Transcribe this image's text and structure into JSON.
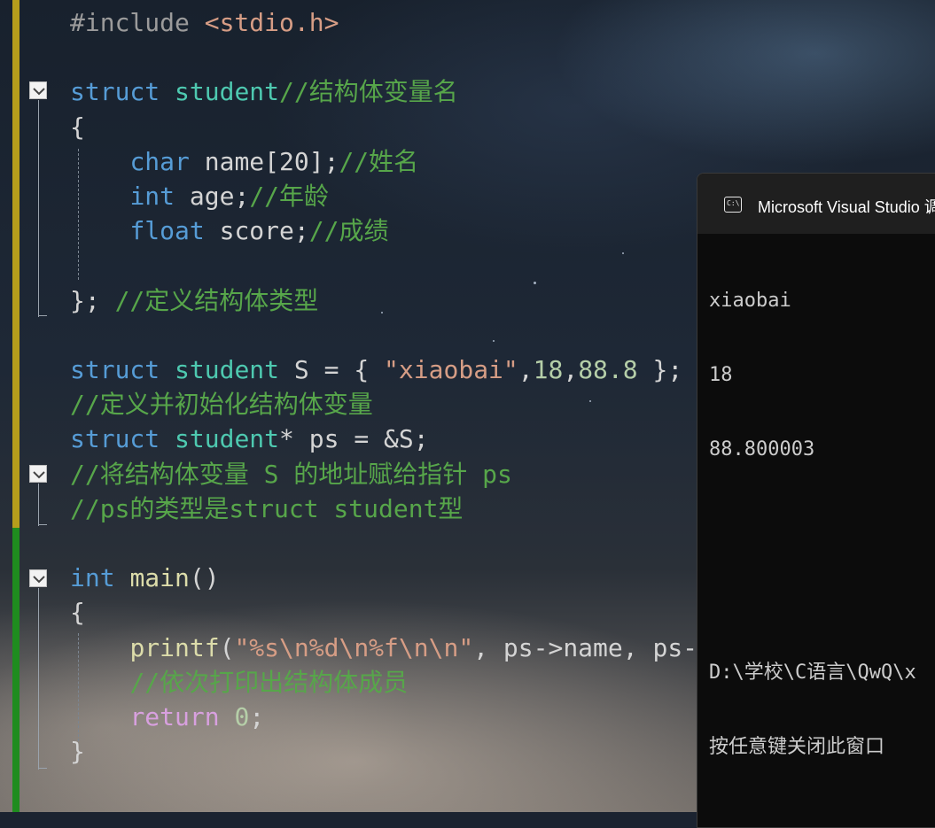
{
  "editor": {
    "lines": [
      {
        "tokens": [
          [
            "pp",
            "#include "
          ],
          [
            "st",
            "<stdio.h>"
          ]
        ]
      },
      {
        "tokens": []
      },
      {
        "tokens": [
          [
            "kw",
            "struct"
          ],
          [
            "pl",
            " "
          ],
          [
            "ty",
            "student"
          ],
          [
            "cm",
            "//结构体变量名"
          ]
        ]
      },
      {
        "tokens": [
          [
            "pl",
            "{"
          ]
        ]
      },
      {
        "tokens": [
          [
            "pl",
            "    "
          ],
          [
            "kw",
            "char"
          ],
          [
            "pl",
            " name[20];"
          ],
          [
            "cm",
            "//姓名"
          ]
        ]
      },
      {
        "tokens": [
          [
            "pl",
            "    "
          ],
          [
            "kw",
            "int"
          ],
          [
            "pl",
            " age;"
          ],
          [
            "cm",
            "//年龄"
          ]
        ]
      },
      {
        "tokens": [
          [
            "pl",
            "    "
          ],
          [
            "kw",
            "float"
          ],
          [
            "pl",
            " score;"
          ],
          [
            "cm",
            "//成绩"
          ]
        ]
      },
      {
        "tokens": []
      },
      {
        "tokens": [
          [
            "pl",
            "}; "
          ],
          [
            "cm",
            "//定义结构体类型"
          ]
        ]
      },
      {
        "tokens": []
      },
      {
        "tokens": [
          [
            "kw",
            "struct"
          ],
          [
            "pl",
            " "
          ],
          [
            "ty",
            "student"
          ],
          [
            "pl",
            " S = { "
          ],
          [
            "st",
            "\"xiaobai\""
          ],
          [
            "pl",
            ","
          ],
          [
            "nm",
            "18"
          ],
          [
            "pl",
            ","
          ],
          [
            "nm",
            "88.8"
          ],
          [
            "pl",
            " };"
          ]
        ]
      },
      {
        "tokens": [
          [
            "cm",
            "//定义并初始化结构体变量"
          ]
        ]
      },
      {
        "tokens": [
          [
            "kw",
            "struct"
          ],
          [
            "pl",
            " "
          ],
          [
            "ty",
            "student"
          ],
          [
            "pl",
            "* ps = &S;"
          ]
        ]
      },
      {
        "tokens": [
          [
            "cm",
            "//将结构体变量 S 的地址赋给指针 ps"
          ]
        ]
      },
      {
        "tokens": [
          [
            "cm",
            "//ps的类型是struct student型"
          ]
        ]
      },
      {
        "tokens": []
      },
      {
        "tokens": [
          [
            "kw",
            "int"
          ],
          [
            "pl",
            " "
          ],
          [
            "fn",
            "main"
          ],
          [
            "pl",
            "()"
          ]
        ]
      },
      {
        "tokens": [
          [
            "pl",
            "{"
          ]
        ]
      },
      {
        "tokens": [
          [
            "pl",
            "    "
          ],
          [
            "fn",
            "printf"
          ],
          [
            "pl",
            "("
          ],
          [
            "st",
            "\"%s\\n%d\\n%f\\n\\n\""
          ],
          [
            "pl",
            ", ps->name, ps->ag"
          ]
        ]
      },
      {
        "tokens": [
          [
            "pl",
            "    "
          ],
          [
            "cm",
            "//依次打印出结构体成员"
          ]
        ]
      },
      {
        "tokens": [
          [
            "pl",
            "    "
          ],
          [
            "ctl",
            "return"
          ],
          [
            "pl",
            " "
          ],
          [
            "nm",
            "0"
          ],
          [
            "pl",
            ";"
          ]
        ]
      },
      {
        "tokens": [
          [
            "pl",
            "}"
          ]
        ]
      }
    ]
  },
  "console": {
    "title": "Microsoft Visual Studio 调",
    "icon": "console-app-icon",
    "output": [
      "xiaobai",
      "18",
      "88.800003",
      "",
      "",
      "D:\\学校\\C语言\\QwQ\\x",
      "按任意键关闭此窗口"
    ]
  },
  "colors": {
    "keyword": "#569cd6",
    "type": "#4ec9b0",
    "comment": "#57a64a",
    "string": "#d69d85",
    "number": "#b5cea8",
    "control": "#d8a0df",
    "function": "#dcdcaa",
    "plain": "#d4d4d4",
    "gutter_changed_saved": "#1f8c1f",
    "gutter_changed_unsaved": "#b59d1c"
  }
}
